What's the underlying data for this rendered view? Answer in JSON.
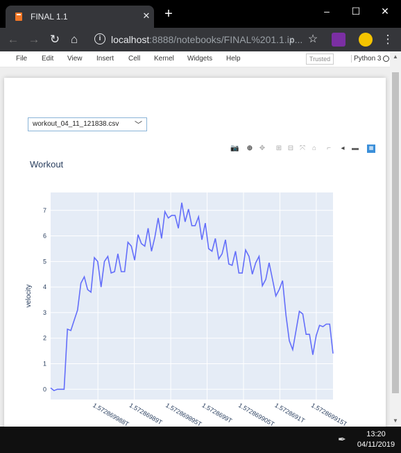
{
  "browser": {
    "tab_title": "FINAL 1.1",
    "tab_close": "✕",
    "new_tab": "+",
    "url_host": "localhost",
    "url_rest": ":8888/notebooks/FINAL%201.1.ip...",
    "window_buttons": [
      "–",
      "☐",
      "✕"
    ]
  },
  "jupyter": {
    "menu": [
      "File",
      "Edit",
      "View",
      "Insert",
      "Cell",
      "Kernel",
      "Widgets",
      "Help"
    ],
    "trusted": "Trusted",
    "kernel": "Python 3"
  },
  "widget": {
    "dropdown_value": "workout_04_11_121838.csv"
  },
  "plot": {
    "title": "Workout",
    "modebar_icons": [
      "camera-icon",
      "zoom-icon",
      "pan-icon",
      "zoom-in-icon",
      "zoom-out-icon",
      "autoscale-icon",
      "reset-axes-icon",
      "spike-lines-icon",
      "hover-closest-icon",
      "hover-compare-icon",
      "plotly-logo-icon"
    ]
  },
  "chart_data": {
    "type": "line",
    "title": "Workout",
    "ylabel": "velocity",
    "xlabel": "",
    "ylim": [
      -0.4,
      7.7
    ],
    "yticks": [
      0,
      1,
      2,
      3,
      4,
      5,
      6,
      7
    ],
    "xtick_labels": [
      "1.572869988T",
      "1.57286989T",
      "1.572869895T",
      "1.5728699T",
      "1.572869905T",
      "1.5728691T",
      "1.572869915T"
    ],
    "xtick_positions": [
      1.572869885,
      1.57286989,
      1.572869895,
      1.5728699,
      1.572869905,
      1.57286991,
      1.572869915
    ],
    "xlim": [
      1.5728698785,
      1.5728699173
    ],
    "color": "#636efa",
    "series": [
      {
        "x_start": 1.5728698785,
        "x_end": 1.5728699173,
        "values": [
          0.05,
          -0.05,
          0.0,
          0.0,
          0.0,
          2.35,
          2.3,
          2.7,
          3.1,
          4.15,
          4.4,
          3.9,
          3.8,
          5.15,
          5.0,
          4.0,
          5.0,
          5.2,
          4.55,
          4.6,
          5.3,
          4.6,
          4.6,
          5.75,
          5.6,
          5.05,
          6.05,
          5.7,
          5.6,
          6.3,
          5.4,
          5.95,
          6.7,
          5.9,
          6.95,
          6.7,
          6.8,
          6.8,
          6.3,
          7.3,
          6.55,
          7.05,
          6.4,
          6.4,
          6.75,
          5.85,
          6.5,
          5.5,
          5.4,
          5.9,
          5.1,
          5.3,
          5.85,
          4.9,
          4.85,
          5.4,
          4.55,
          4.55,
          5.45,
          5.2,
          4.5,
          4.95,
          5.2,
          4.05,
          4.3,
          4.95,
          4.3,
          3.65,
          3.9,
          4.25,
          2.9,
          1.9,
          1.55,
          2.3,
          3.05,
          2.95,
          2.15,
          2.15,
          1.35,
          2.1,
          2.5,
          2.45,
          2.55,
          2.55,
          1.4
        ]
      }
    ],
    "grid": true
  },
  "taskbar": {
    "time": "13:20",
    "date": "04/11/2019"
  }
}
